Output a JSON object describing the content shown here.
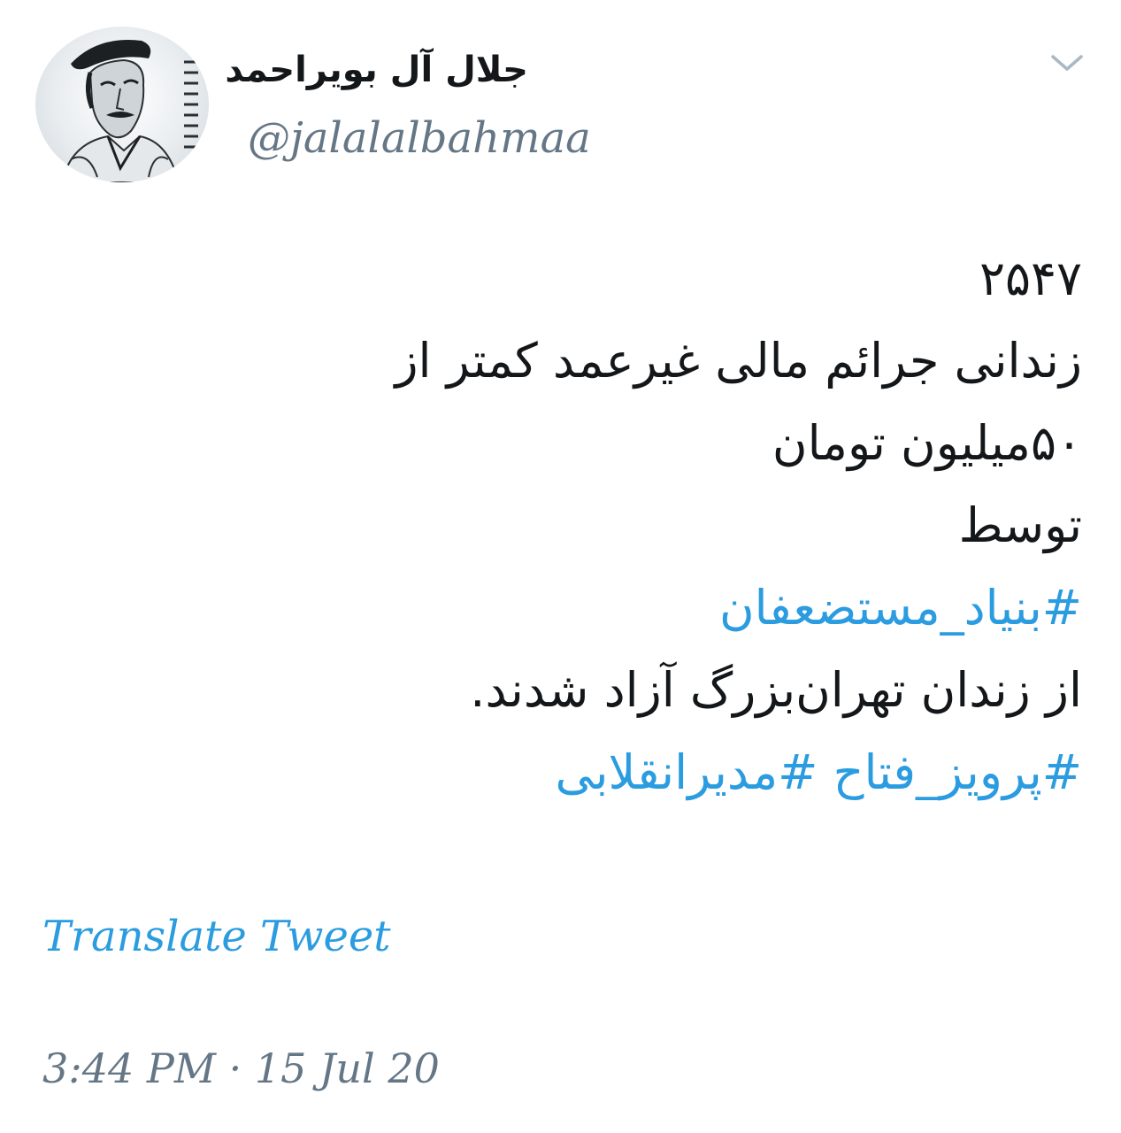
{
  "tweet": {
    "author": {
      "display_name": "جلال آل بویراحمد",
      "handle": "@jalalalbahmaa",
      "avatar_icon": "portrait-sketch-icon"
    },
    "menu_icon": "chevron-down-icon",
    "lines": [
      {
        "text": "۲۵۴۷",
        "type": "text"
      },
      {
        "text": "زندانی جرائم مالی غیرعمد کمتر از",
        "type": "text"
      },
      {
        "text": "۵۰میلیون تومان",
        "type": "text"
      },
      {
        "text": "توسط",
        "type": "text"
      },
      {
        "text": "#بنیاد_مستضعفان",
        "type": "hashtag"
      },
      {
        "text": "از زندان تهران‌بزرگ آزاد شدند.",
        "type": "text"
      },
      {
        "text": "#پرویز_فتاح #مدیرانقلابی",
        "type": "hashtag"
      }
    ],
    "translate_label": "Translate Tweet",
    "timestamp": "3:44 PM · 15 Jul 20"
  },
  "colors": {
    "hashtag": "#2b9ce0",
    "secondary_text": "#657786",
    "primary_text": "#14171a"
  }
}
